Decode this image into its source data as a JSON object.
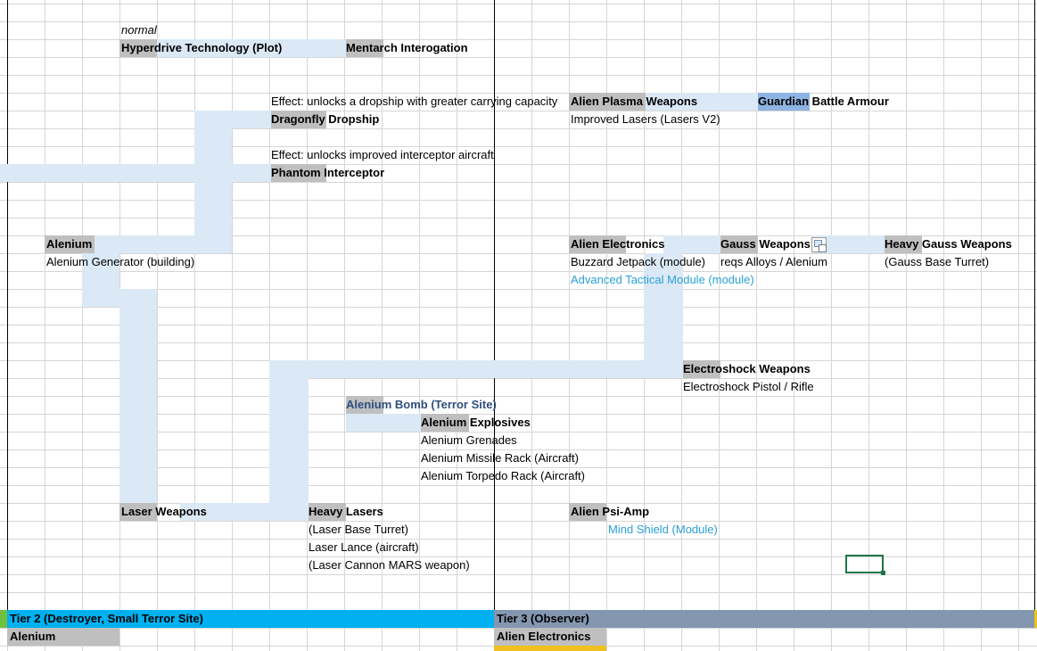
{
  "sheet": {
    "style_label": "normal",
    "accent_colors": {
      "connector": "#dbe9f6",
      "header_gray": "#bfbfbf",
      "tier2": "#00b0f0",
      "tier3": "#8497b0",
      "cyan_text": "#2aa0d8"
    },
    "nodes": {
      "hyperdrive": "Hyperdrive Technology (Plot)",
      "mentarch": "Mentarch Interogation",
      "dropship_effect": "Effect: unlocks a dropship with greater carrying capacity",
      "dragonfly": "Dragonfly Dropship",
      "interceptor_effect": "Effect: unlocks improved interceptor aircraft",
      "phantom": "Phantom Interceptor",
      "alien_plasma": "Alien Plasma Weapons",
      "improved_lasers": "Improved Lasers (Lasers V2)",
      "guardian": "Guardian Battle Armour",
      "alenium": "Alenium",
      "alenium_generator": "Alenium Generator (building)",
      "alien_electronics": "Alien Electronics",
      "buzzard": "Buzzard Jetpack (module)",
      "advanced_tactical": "Advanced Tactical Module (module)",
      "gauss": "Gauss Weapons",
      "gauss_reqs": "reqs Alloys / Alenium",
      "heavy_gauss": "Heavy Gauss Weapons",
      "gauss_turret": "(Gauss Base Turret)",
      "electroshock": "Electroshock Weapons",
      "electroshock_items": "Electroshock Pistol / Rifle",
      "alenium_bomb": "Alenium Bomb (Terror Site)",
      "alenium_explosives": "Alenium Explosives",
      "alenium_grenades": "Alenium Grenades",
      "alenium_missile": "Alenium Missile Rack (Aircraft)",
      "alenium_torpedo": "Alenium Torpedo Rack (Aircraft)",
      "laser_weapons": "Laser Weapons",
      "heavy_lasers": "Heavy Lasers",
      "laser_turret": "(Laser Base Turret)",
      "laser_lance": "Laser Lance (aircraft)",
      "laser_cannon": "(Laser Cannon MARS weapon)",
      "alien_psi_amp": "Alien Psi-Amp",
      "mind_shield": "Mind Shield (Module)"
    },
    "tiers": {
      "tier2": "Tier 2 (Destroyer, Small Terror Site)",
      "tier2_item": "Alenium",
      "tier3": "Tier 3 (Observer)",
      "tier3_item": "Alien Electronics"
    }
  }
}
